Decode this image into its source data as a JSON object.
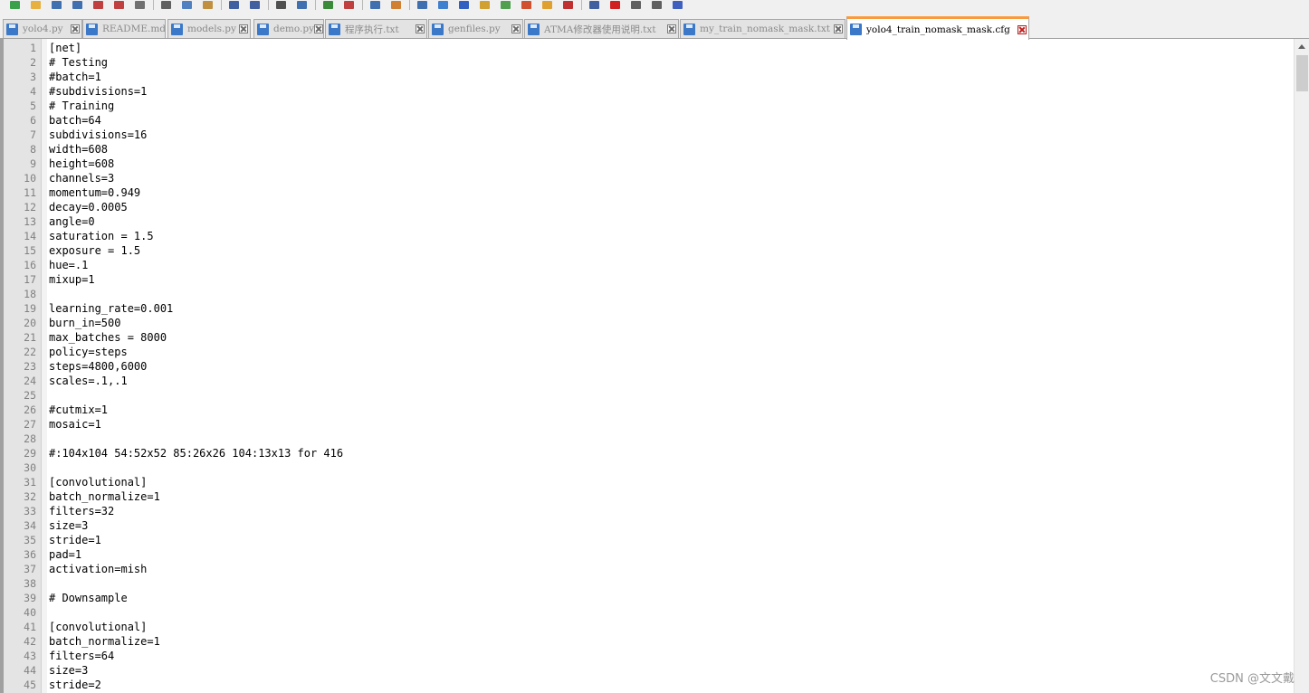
{
  "toolbar": {
    "icons": [
      "new-file-icon",
      "open-file-icon",
      "save-icon",
      "save-all-icon",
      "close-icon",
      "close-all-icon",
      "print-icon",
      "cut-icon",
      "copy-icon",
      "paste-icon",
      "undo-icon",
      "redo-icon",
      "find-icon",
      "replace-icon",
      "zoom-in-icon",
      "zoom-out-icon",
      "sync-vertical-icon",
      "sync-horizontal-icon",
      "word-wrap-icon",
      "show-all-chars-icon",
      "indent-guide-icon",
      "language-icon",
      "doc-map-icon",
      "function-list-icon",
      "folder-workspace-icon",
      "monitor-icon",
      "record-macro-icon",
      "stop-macro-icon",
      "play-macro-icon",
      "run-macro-multiple-icon",
      "save-macro-icon"
    ]
  },
  "tabs": [
    {
      "label": "yolo4.py",
      "active": false
    },
    {
      "label": "README.md",
      "active": false
    },
    {
      "label": "models.py",
      "active": false
    },
    {
      "label": "demo.py",
      "active": false
    },
    {
      "label": "程序执行.txt",
      "active": false
    },
    {
      "label": "genfiles.py",
      "active": false
    },
    {
      "label": "ATMA修改器使用说明.txt",
      "active": false
    },
    {
      "label": "my_train_nomask_mask.txt",
      "active": false
    },
    {
      "label": "yolo4_train_nomask_mask.cfg",
      "active": true
    }
  ],
  "editor": {
    "lines": [
      "[net]",
      "# Testing",
      "#batch=1",
      "#subdivisions=1",
      "# Training",
      "batch=64",
      "subdivisions=16",
      "width=608",
      "height=608",
      "channels=3",
      "momentum=0.949",
      "decay=0.0005",
      "angle=0",
      "saturation = 1.5",
      "exposure = 1.5",
      "hue=.1",
      "mixup=1",
      "",
      "learning_rate=0.001",
      "burn_in=500",
      "max_batches = 8000",
      "policy=steps",
      "steps=4800,6000",
      "scales=.1,.1",
      "",
      "#cutmix=1",
      "mosaic=1",
      "",
      "#:104x104 54:52x52 85:26x26 104:13x13 for 416",
      "",
      "[convolutional]",
      "batch_normalize=1",
      "filters=32",
      "size=3",
      "stride=1",
      "pad=1",
      "activation=mish",
      "",
      "# Downsample",
      "",
      "[convolutional]",
      "batch_normalize=1",
      "filters=64",
      "size=3",
      "stride=2"
    ]
  },
  "watermark": "CSDN @文文戴"
}
